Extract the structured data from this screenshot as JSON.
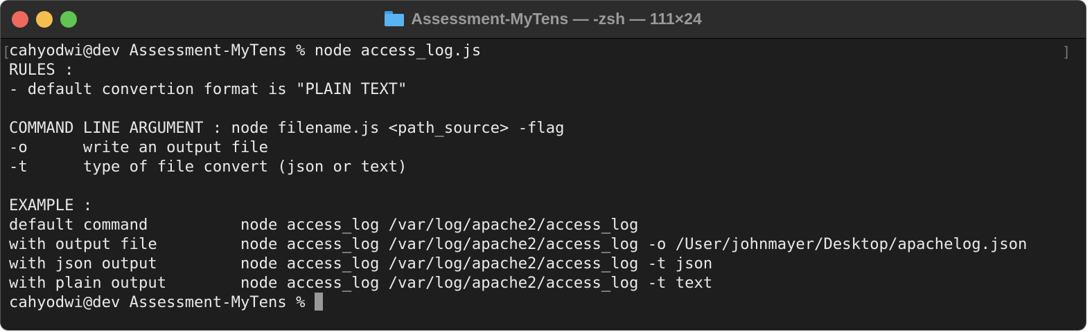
{
  "window": {
    "title": "Assessment-MyTens — -zsh — 111×24",
    "title_icon": "folder-icon"
  },
  "terminal": {
    "lines": [
      "cahyodwi@dev Assessment-MyTens % node access_log.js",
      "RULES :",
      "- default convertion format is \"PLAIN TEXT\"",
      "",
      "COMMAND LINE ARGUMENT : node filename.js <path_source> -flag",
      "-o      write an output file",
      "-t      type of file convert (json or text)",
      "",
      "EXAMPLE :",
      "default command          node access_log /var/log/apache2/access_log",
      "with output file         node access_log /var/log/apache2/access_log -o /User/johnmayer/Desktop/apachelog.json",
      "with json output         node access_log /var/log/apache2/access_log -t json",
      "with plain output        node access_log /var/log/apache2/access_log -t text"
    ],
    "prompt": "cahyodwi@dev Assessment-MyTens % "
  }
}
